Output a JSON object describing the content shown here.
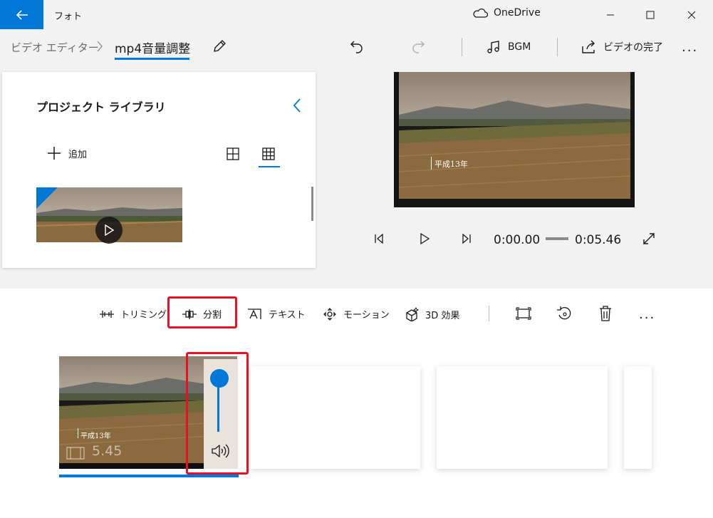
{
  "window": {
    "app_title": "フォト",
    "onedrive_label": "OneDrive"
  },
  "breadcrumb": {
    "root": "ビデオ エディター",
    "current": "mp4音量調整"
  },
  "toolbar": {
    "bgm_label": "BGM",
    "finish_label": "ビデオの完了",
    "more_label": "..."
  },
  "library": {
    "title": "プロジェクト ライブラリ",
    "add_label": "追加"
  },
  "preview": {
    "caption": "平成13年",
    "current_time": "0:00.00",
    "total_time": "0:05.46"
  },
  "storyboard_toolbar": {
    "trim": "トリミング",
    "split": "分割",
    "text": "テキスト",
    "motion": "モーション",
    "effects3d": "3D 効果",
    "more": "..."
  },
  "storyboard": {
    "clip1": {
      "caption": "平成13年",
      "duration": "5.45",
      "volume_level": 1.0
    }
  },
  "colors": {
    "accent": "#0078d7",
    "highlight": "#e81123",
    "chrome": "#f2f2f2"
  }
}
